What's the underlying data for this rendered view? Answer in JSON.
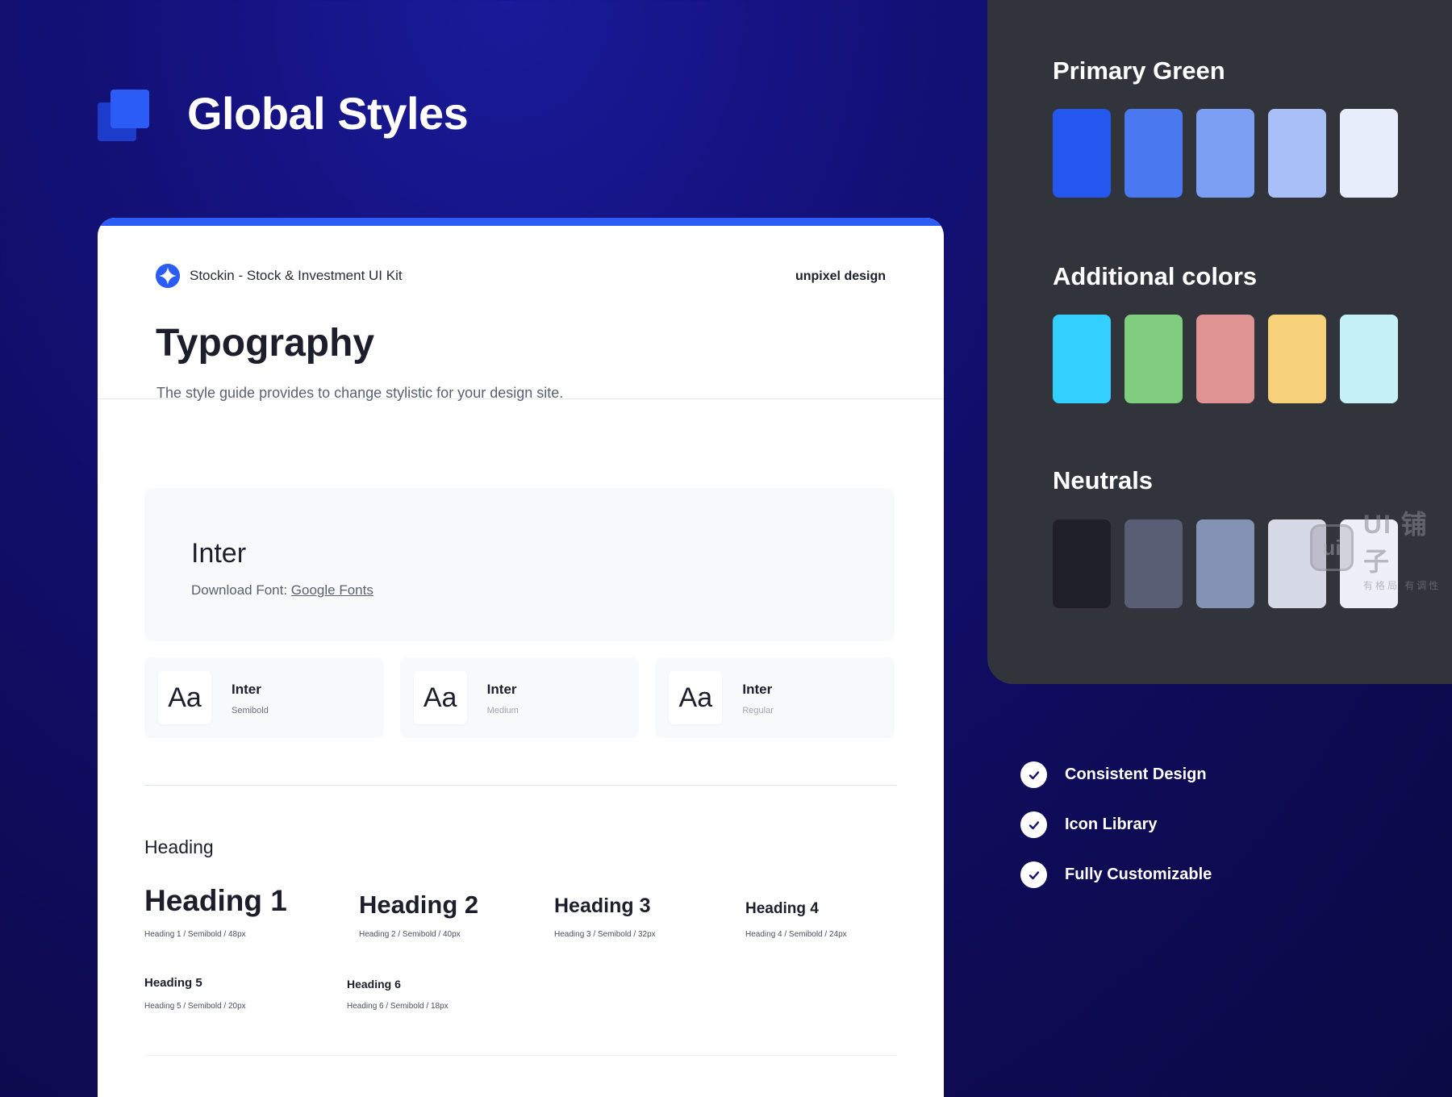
{
  "header": {
    "title": "Global Styles"
  },
  "card": {
    "brand": "Stockin - Stock & Investment UI Kit",
    "company": "unpixel design",
    "title": "Typography",
    "subtitle": "The style guide provides to change stylistic for your design site.",
    "font": {
      "name": "Inter",
      "download_prefix": "Download Font: ",
      "download_link": "Google Fonts"
    },
    "weights": [
      {
        "sample": "Aa",
        "name": "Inter",
        "style": "Semibold"
      },
      {
        "sample": "Aa",
        "name": "Inter",
        "style": "Medium"
      },
      {
        "sample": "Aa",
        "name": "Inter",
        "style": "Regular"
      }
    ],
    "heading_section": "Heading",
    "headings": [
      {
        "label": "Heading 1",
        "caption": "Heading 1 / Semibold / 48px"
      },
      {
        "label": "Heading 2",
        "caption": "Heading 2 / Semibold / 40px"
      },
      {
        "label": "Heading 3",
        "caption": "Heading 3 / Semibold / 32px"
      },
      {
        "label": "Heading 4",
        "caption": "Heading 4 / Semibold / 24px"
      },
      {
        "label": "Heading 5",
        "caption": "Heading 5 / Semibold / 20px"
      },
      {
        "label": "Heading 6",
        "caption": "Heading 6 / Semibold / 18px"
      }
    ]
  },
  "panel": {
    "primary": {
      "title": "Primary Green",
      "colors": [
        "#2457f0",
        "#4a78f0",
        "#7c9ff4",
        "#a9bff7",
        "#e8edfb"
      ]
    },
    "additional": {
      "title": "Additional colors",
      "colors": [
        "#33cfff",
        "#80cd80",
        "#e09393",
        "#f6d17a",
        "#c6f1f7"
      ]
    },
    "neutrals": {
      "title": "Neutrals",
      "colors": [
        "#1f2028",
        "#595e75",
        "#8492b4",
        "#d6d9e6",
        "#eef0f7"
      ]
    }
  },
  "watermark": {
    "badge": "ui",
    "big": "UI 铺子",
    "small": "有格局 有调性"
  },
  "features": [
    "Consistent Design",
    "Icon Library",
    "Fully Customizable"
  ]
}
